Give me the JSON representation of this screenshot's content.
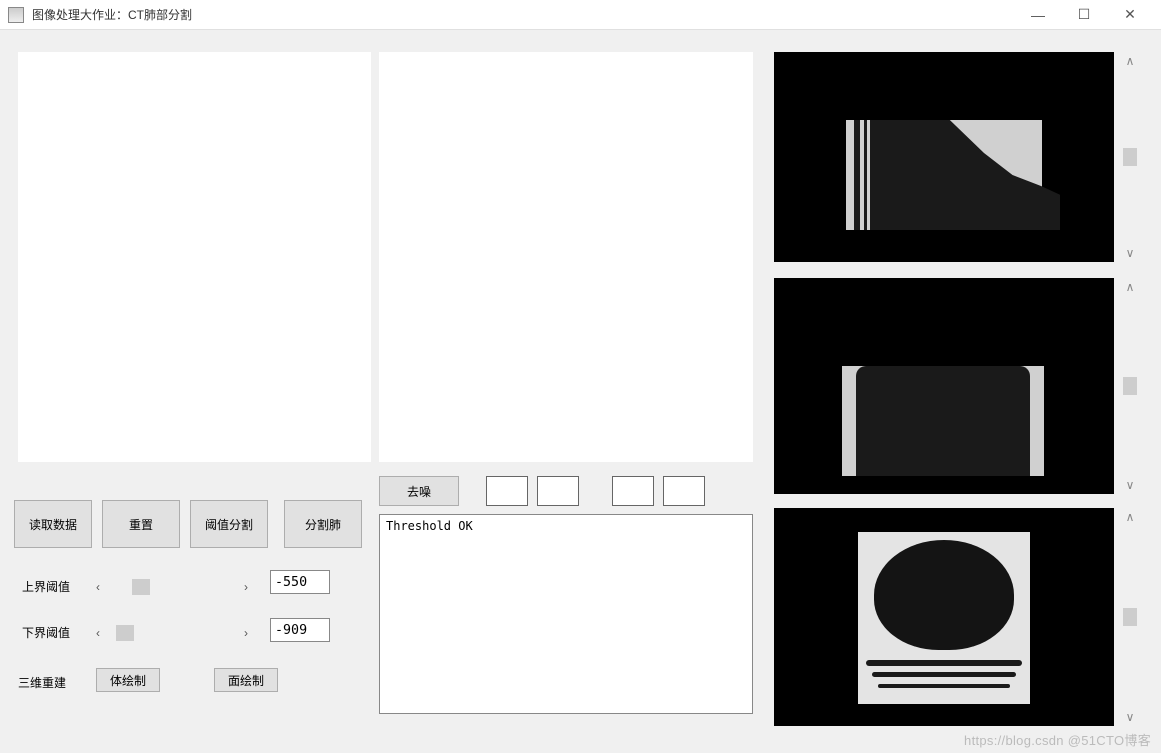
{
  "window": {
    "title": "图像处理大作业：CT肺部分割",
    "minimize": "—",
    "maximize": "☐",
    "close": "✕"
  },
  "buttons": {
    "denoise": "去噪",
    "read_data": "读取数据",
    "reset": "重置",
    "threshold_seg": "阈值分割",
    "segment_lung": "分割肺",
    "volume_render": "体绘制",
    "surface_render": "面绘制"
  },
  "labels": {
    "upper_threshold": "上界阈值",
    "lower_threshold": "下界阈值",
    "reconstruct_3d": "三维重建"
  },
  "threshold": {
    "upper": "-550",
    "lower": "-909"
  },
  "log": {
    "text": "Threshold OK"
  },
  "scroll": {
    "up": "∧",
    "down": "∨"
  },
  "slider": {
    "left": "‹",
    "right": "›"
  },
  "watermark": "https://blog.csdn  @51CTO博客"
}
